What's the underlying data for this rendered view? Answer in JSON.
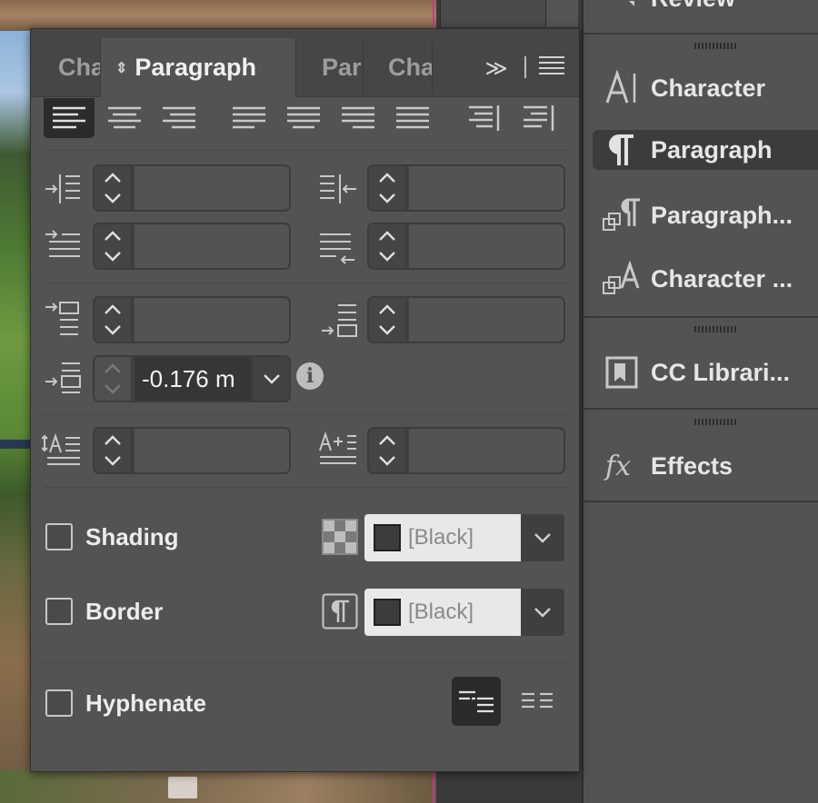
{
  "panel": {
    "tabs": [
      {
        "label": "Character"
      },
      {
        "label": "Paragraph",
        "active": true
      },
      {
        "label": "Paragraph Styles"
      },
      {
        "label": "Character Styles"
      }
    ],
    "collapse_icon": "double-chevron-right-icon",
    "menu_icon": "panel-menu-icon",
    "alignment": {
      "buttons": [
        "align-left",
        "align-center",
        "align-right",
        "justify-left",
        "justify-center",
        "justify-right",
        "justify-all",
        "align-towards-spine",
        "align-away-from-spine"
      ],
      "selected": "align-left"
    },
    "indents": {
      "left_indent": "",
      "right_indent": "",
      "first_line_indent": "",
      "last_line_right_indent": ""
    },
    "spacing": {
      "space_before": "",
      "space_after": "",
      "space_between": "-0.176 m"
    },
    "drop_cap": {
      "lines": "",
      "characters": ""
    },
    "shading": {
      "label": "Shading",
      "checked": false,
      "color": "[Black]"
    },
    "border": {
      "label": "Border",
      "checked": false,
      "color": "[Black]"
    },
    "hyphenate": {
      "label": "Hyphenate",
      "checked": false
    }
  },
  "dock": {
    "review_label": "Review",
    "items": [
      {
        "label": "Character",
        "icon": "character-icon"
      },
      {
        "label": "Paragraph",
        "icon": "paragraph-icon",
        "active": true
      },
      {
        "label": "Paragraph...",
        "icon": "paragraph-styles-icon"
      },
      {
        "label": "Character ...",
        "icon": "character-styles-icon"
      },
      {
        "label": "CC Librari...",
        "icon": "cc-libraries-icon"
      },
      {
        "label": "Effects",
        "icon": "effects-icon"
      }
    ]
  },
  "colors": {
    "panel_bg": "#535353",
    "dock_bg": "#535353",
    "accent_guide": "#c13b8a"
  }
}
